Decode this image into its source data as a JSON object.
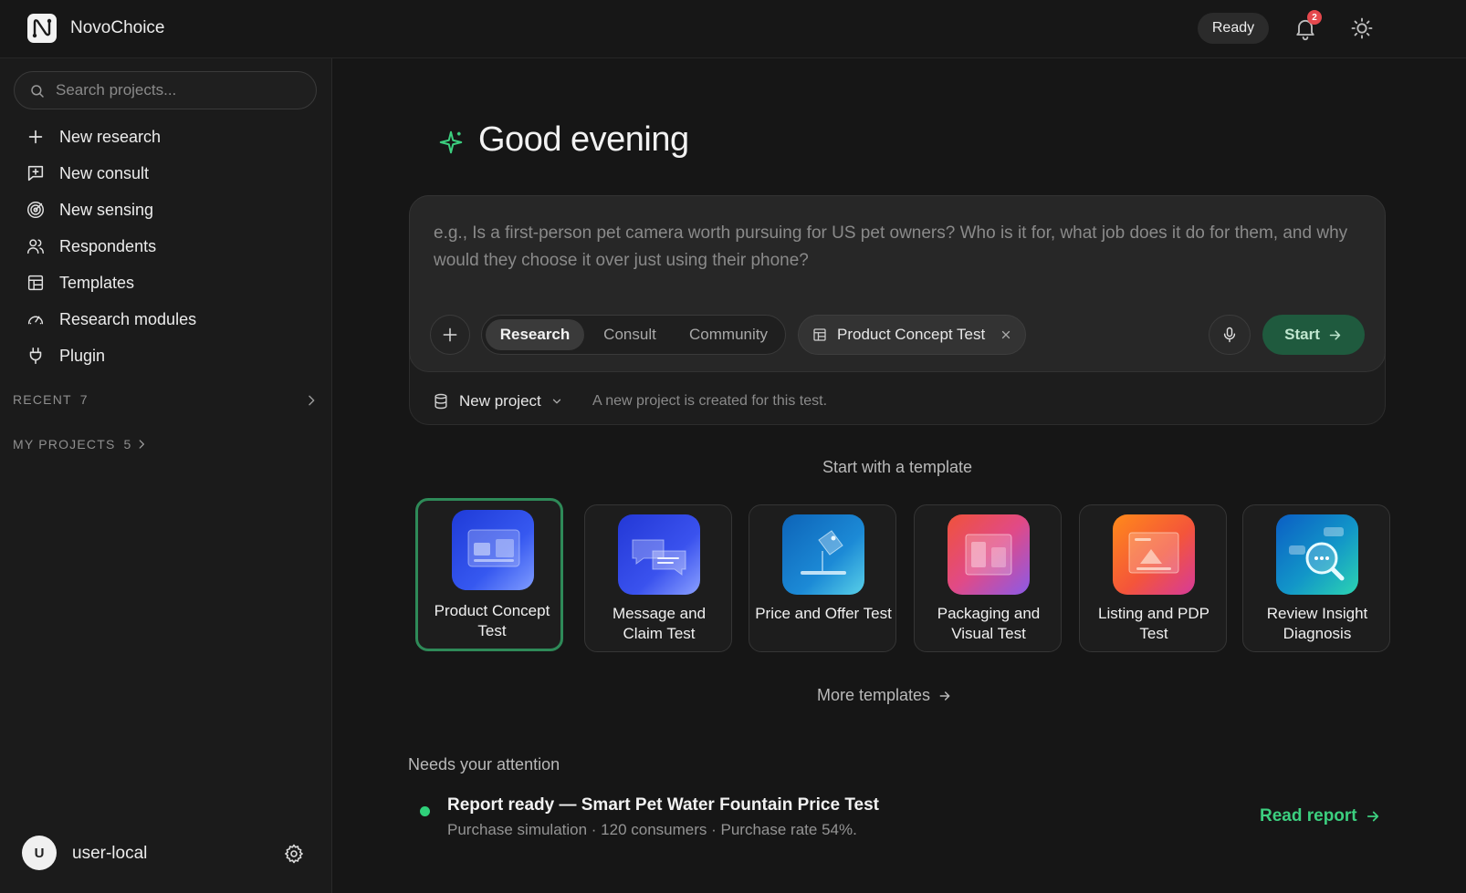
{
  "app": {
    "name": "NovoChoice",
    "status": "Ready",
    "notification_count": "2",
    "accent_color": "#2fd07a",
    "icons": {
      "logo": "novochoice-logo-icon",
      "notifications": "bell-icon",
      "theme": "sun-icon"
    }
  },
  "sidebar": {
    "search_placeholder": "Search projects...",
    "items": [
      {
        "label": "New research",
        "icon": "plus-icon"
      },
      {
        "label": "New consult",
        "icon": "chat-plus-icon"
      },
      {
        "label": "New sensing",
        "icon": "radar-icon"
      },
      {
        "label": "Respondents",
        "icon": "users-icon"
      },
      {
        "label": "Templates",
        "icon": "layout-icon"
      },
      {
        "label": "Research modules",
        "icon": "gauge-icon"
      },
      {
        "label": "Plugin",
        "icon": "plug-icon"
      }
    ],
    "recent": {
      "label": "RECENT",
      "count": "7"
    },
    "projects": {
      "label": "MY PROJECTS",
      "count": "5"
    },
    "user": {
      "initial": "U",
      "name": "user-local"
    }
  },
  "main": {
    "greeting": "Good evening",
    "composer": {
      "placeholder": "e.g., Is a first-person pet camera worth pursuing for US pet owners? Who is it for, what job does it do for them, and why would they choose it over just using their phone?",
      "modes": [
        "Research",
        "Consult",
        "Community"
      ],
      "active_mode": "Research",
      "selected_template": "Product Concept Test",
      "start_label": "Start",
      "project_label": "New project",
      "project_note": "A new project is created for this test."
    },
    "templates_heading": "Start with a template",
    "templates": [
      {
        "name": "Product Concept Test",
        "selected": true
      },
      {
        "name": "Message and Claim Test",
        "selected": false
      },
      {
        "name": "Price and Offer Test",
        "selected": false
      },
      {
        "name": "Packaging and Visual Test",
        "selected": false
      },
      {
        "name": "Listing and PDP Test",
        "selected": false
      },
      {
        "name": "Review Insight Diagnosis",
        "selected": false
      }
    ],
    "more_templates": "More templates",
    "attention": {
      "heading": "Needs your attention",
      "title": "Report ready — Smart Pet Water Fountain Price Test",
      "subtitle": "Purchase simulation · 120 consumers · Purchase rate 54%.",
      "action": "Read report"
    }
  }
}
